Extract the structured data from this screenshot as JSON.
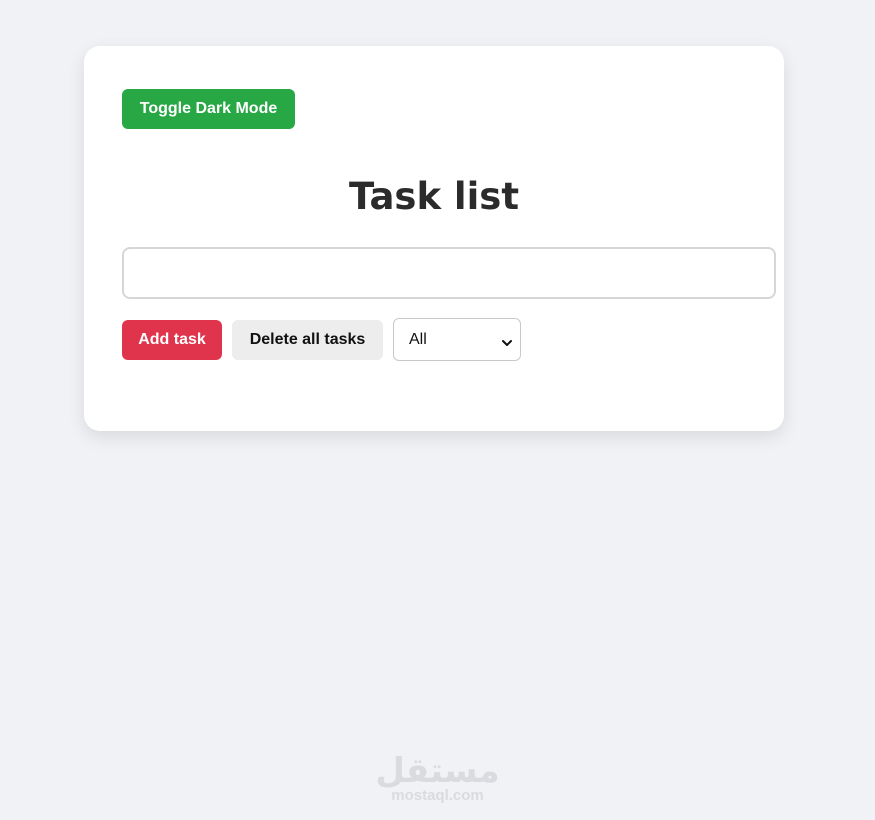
{
  "toolbar": {
    "toggle_dark_mode_label": "Toggle Dark Mode"
  },
  "main": {
    "title": "Task list",
    "task_input": {
      "value": "",
      "placeholder": ""
    },
    "add_task_label": "Add task",
    "delete_all_label": "Delete all tasks",
    "filter": {
      "selected": "All",
      "icon": "chevron-down-icon"
    }
  },
  "watermark": {
    "logo_text": "مستقل",
    "url": "mostaql.com"
  },
  "colors": {
    "background": "#f0f2f5",
    "card": "#ffffff",
    "toggle_button": "#28a745",
    "add_button": "#e0334c",
    "delete_button": "#ededed",
    "title_text": "#2b2b2b",
    "watermark": "#d9dbe0"
  }
}
